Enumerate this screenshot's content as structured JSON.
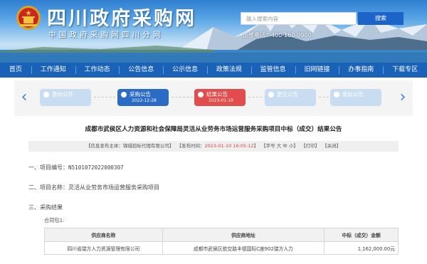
{
  "header": {
    "site_title": "四川政府采购网",
    "site_subtitle": "中国政府采购网四川分网",
    "search_placeholder": "输入搜索内容",
    "search_button": "搜索",
    "hotline": "运维电话：400-160-0900"
  },
  "nav": {
    "items": [
      "首页",
      "工作通知",
      "工作动态",
      "公告信息",
      "公示信息",
      "政策法规",
      "监管信息",
      "旧网链接",
      "办事指南",
      "下载专区"
    ]
  },
  "stepper": {
    "prev_icon": "chevron-left-icon",
    "next_icon": "chevron-right-icon",
    "steps": [
      {
        "label": "意向公开",
        "date": ""
      },
      {
        "label": "采购公告",
        "date": "2022-12-28"
      },
      {
        "label": "结果公告",
        "date": "2023-01-10"
      },
      {
        "label": "更正公告",
        "date": ""
      },
      {
        "label": "废标公告",
        "date": ""
      }
    ]
  },
  "article": {
    "title": "成都市武侯区人力资源和社会保障局灵活从业劳务市场运营服务采购项目中标（成交）结果公告",
    "meta": {
      "publisher_prefix": "【信息发布主体：",
      "publisher": "锦城招标代理有限公司",
      "publisher_suffix": "】",
      "time_prefix": "【发布时间：",
      "time": "2023-01-10 16:05:12",
      "time_suffix": "】",
      "font_size": "【字号 大 中 小】",
      "print": "【打印】",
      "close": "【关闭】"
    },
    "project_no_label": "一、项目编号：",
    "project_no": "N5101072022000307",
    "project_name_label": "二、项目名称：",
    "project_name": "灵活从业劳务市场运营服务采购项目",
    "result_label": "三、采购结果",
    "package": "合同包1:",
    "table": {
      "headers": [
        "供应商名称",
        "供应商地址",
        "中标（成交）金额"
      ],
      "rows": [
        [
          "四川省瑞方人力资源管理有限公司",
          "成都市武侯区航空路丰德国际C座902瑞方人力",
          "1,162,000.00元"
        ]
      ]
    }
  },
  "colors": {
    "nav_bg": "#1a61b8",
    "step_active": "#2a6bc6",
    "step_result": "#e24c4c",
    "step_inactive": "#c9ddf2",
    "publish_time": "#e0403a"
  }
}
